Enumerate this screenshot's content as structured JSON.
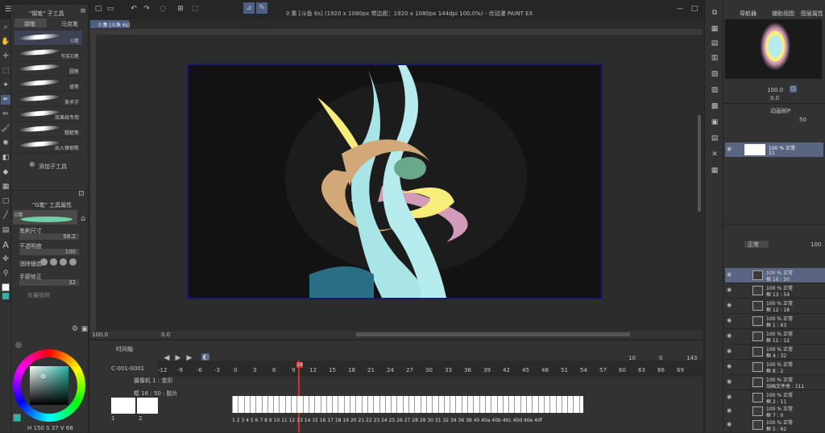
{
  "title_bar": {
    "title": "0 集 [斗鱼 6s] (1920 x 1080px 带边距：1920 x 1080px 144dpi 100.0%) - 优动漫 PAINT EX"
  },
  "canvas_tab": {
    "label": "0 集 [斗鱼 6s]"
  },
  "subtool_panel": {
    "header": "\"钢笔\" 子工具",
    "tabs": [
      "钢笔",
      "马克笔"
    ],
    "brushes": [
      "G笔",
      "写实G笔",
      "圆笔",
      "填笔",
      "美术字",
      "效果线专用",
      "粗糙笔",
      "出入锋钢笔"
    ],
    "add_label": "添加子工具"
  },
  "tool_property": {
    "header": "\"G笔\" 工具属性",
    "preview_label": "G笔",
    "brush_size_label": "笔刷尺寸",
    "brush_size_value": "58.2",
    "opacity_label": "不透明度",
    "opacity_value": "100",
    "antialias_label": "消除锯齿",
    "stabilize_label": "手颤修正",
    "stabilize_value": "32",
    "vector_label": "矢量吸附"
  },
  "color_panel": {
    "readout": "H 150 S 37 V 68",
    "accent": "#29b6a6"
  },
  "canvas_status": {
    "zoom": "100.0",
    "angle": "0.0"
  },
  "navigator": {
    "tabs": [
      "导航器",
      "辅助视图",
      "图层属性"
    ],
    "zoom": "100.0",
    "rotation": "0.0"
  },
  "anim_cel_panel": {
    "tab": "动画帧P",
    "opacity_value": "50",
    "layer_line1": "100 % 正常",
    "layer_line2": "11"
  },
  "layer_panel": {
    "blend_mode": "正常",
    "opacity": "100",
    "layers": [
      {
        "l1": "100 % 正常",
        "l2": "框 16 : 50"
      },
      {
        "l1": "100 % 正常",
        "l2": "框 13 : 54"
      },
      {
        "l1": "100 % 正常",
        "l2": "框 12 : 18"
      },
      {
        "l1": "100 % 正常",
        "l2": "框 1 : 63"
      },
      {
        "l1": "100 % 正常",
        "l2": "框 11 : 12"
      },
      {
        "l1": "100 % 正常",
        "l2": "框 4 : 32"
      },
      {
        "l1": "100 % 正常",
        "l2": "框 8 : 2"
      },
      {
        "l1": "100 % 正常",
        "l2": "动画文件夹 : 111"
      },
      {
        "l1": "100 % 正常",
        "l2": "框 2 : 11"
      },
      {
        "l1": "100 % 正常",
        "l2": "框 7 : 0"
      },
      {
        "l1": "100 % 正常",
        "l2": "框 5 : 62"
      }
    ]
  },
  "timeline": {
    "tab": "时间轴",
    "name": "C-001-0001",
    "counters": [
      "10",
      "0",
      "143"
    ],
    "track1": "摄像机 1 : 变形",
    "track2": "框 16 : 50 : 胶片",
    "track_left_nums": [
      "1",
      "2"
    ],
    "ruler": [
      "-12",
      "-9",
      "-6",
      "-3",
      "0",
      "3",
      "6",
      "9",
      "12",
      "15",
      "18",
      "21",
      "24",
      "27",
      "30",
      "33",
      "36",
      "39",
      "42",
      "45",
      "48",
      "51",
      "54",
      "57",
      "60",
      "63",
      "66",
      "69"
    ],
    "frame_labels": "1 2 3 4 5 6 7 8 9 10 11 12 13 14 15 16 17 18 19 20 21 22 23 24 25 26 27 28 29 30 31 32   34   36   38   40    40a    40b 40c 40d 40e 40f",
    "current_frame": "10"
  }
}
